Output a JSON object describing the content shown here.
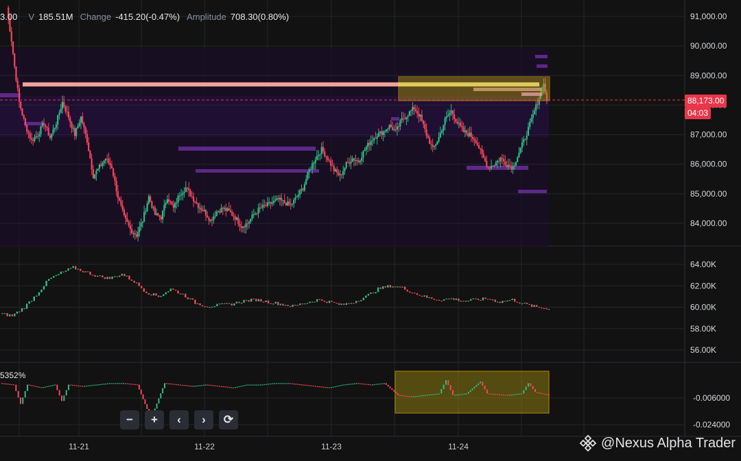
{
  "header": {
    "open_fragment": "3.00",
    "volume_label": "V",
    "volume_value": "185.51M",
    "change_label": "Change",
    "change_value": "-415.20(-0.47%)",
    "amplitude_label": "Amplitude",
    "amplitude_value": "708.30(0.80%)"
  },
  "price_badge": "88,173.00",
  "timer_badge": "04:03",
  "osc_label": "5352%",
  "watermark": "@Nexus Alpha Trader",
  "zoom_controls": [
    {
      "name": "zoom-out-button",
      "label": "−"
    },
    {
      "name": "zoom-in-button",
      "label": "+"
    },
    {
      "name": "scroll-left-button",
      "label": "‹"
    },
    {
      "name": "scroll-right-button",
      "label": "›"
    },
    {
      "name": "reset-button",
      "label": "⟳"
    }
  ],
  "colors": {
    "up": "#2ebd85",
    "down": "#f6465d",
    "accent_yellow": "#f0b90b",
    "grid": "#23262b"
  },
  "chart_data": [
    {
      "type": "candlestick",
      "panel": "price",
      "y_ticks": [
        "91,000.00",
        "90,000.00",
        "89,000.00",
        "88,000.00",
        "87,000.00",
        "86,000.00",
        "85,000.00",
        "84,000.00"
      ],
      "ylim": [
        83300,
        91300
      ],
      "x_ticks": [
        "11-21",
        "11-22",
        "11-23",
        "11-24"
      ],
      "last_price": 88173,
      "resistance_level": 88700,
      "path": [
        [
          0,
          91300
        ],
        [
          3,
          90200
        ],
        [
          5,
          89300
        ],
        [
          8,
          88100
        ],
        [
          12,
          87300
        ],
        [
          16,
          86800
        ],
        [
          20,
          87000
        ],
        [
          24,
          87400
        ],
        [
          28,
          86900
        ],
        [
          32,
          87400
        ],
        [
          36,
          88100
        ],
        [
          40,
          87600
        ],
        [
          44,
          87000
        ],
        [
          48,
          87600
        ],
        [
          52,
          86800
        ],
        [
          56,
          85600
        ],
        [
          60,
          85900
        ],
        [
          64,
          86200
        ],
        [
          68,
          85900
        ],
        [
          72,
          84900
        ],
        [
          76,
          84200
        ],
        [
          80,
          83800
        ],
        [
          84,
          83600
        ],
        [
          88,
          84100
        ],
        [
          92,
          84900
        ],
        [
          96,
          84300
        ],
        [
          100,
          84200
        ],
        [
          104,
          84900
        ],
        [
          108,
          84500
        ],
        [
          112,
          85000
        ],
        [
          116,
          85200
        ],
        [
          120,
          84900
        ],
        [
          124,
          84600
        ],
        [
          128,
          84400
        ],
        [
          132,
          84100
        ],
        [
          136,
          84400
        ],
        [
          140,
          84500
        ],
        [
          144,
          84400
        ],
        [
          148,
          84200
        ],
        [
          152,
          83900
        ],
        [
          156,
          84000
        ],
        [
          160,
          84300
        ],
        [
          164,
          84500
        ],
        [
          168,
          84600
        ],
        [
          172,
          84700
        ],
        [
          176,
          84800
        ],
        [
          180,
          84700
        ],
        [
          184,
          84600
        ],
        [
          188,
          84900
        ],
        [
          192,
          85200
        ],
        [
          196,
          85800
        ],
        [
          200,
          86200
        ],
        [
          204,
          86500
        ],
        [
          208,
          86200
        ],
        [
          212,
          85800
        ],
        [
          216,
          85600
        ],
        [
          220,
          86000
        ],
        [
          224,
          86200
        ],
        [
          228,
          86100
        ],
        [
          232,
          86500
        ],
        [
          236,
          86800
        ],
        [
          240,
          87000
        ],
        [
          244,
          87100
        ],
        [
          248,
          87300
        ],
        [
          252,
          87100
        ],
        [
          256,
          87500
        ],
        [
          260,
          87700
        ],
        [
          264,
          87900
        ],
        [
          268,
          87600
        ],
        [
          272,
          87000
        ],
        [
          276,
          86500
        ],
        [
          280,
          86900
        ],
        [
          284,
          87500
        ],
        [
          288,
          87800
        ],
        [
          292,
          87400
        ],
        [
          296,
          87100
        ],
        [
          300,
          87000
        ],
        [
          304,
          86800
        ],
        [
          308,
          86300
        ],
        [
          312,
          85900
        ],
        [
          316,
          86000
        ],
        [
          320,
          86200
        ],
        [
          324,
          86000
        ],
        [
          328,
          85900
        ],
        [
          332,
          86400
        ],
        [
          336,
          86900
        ],
        [
          340,
          87500
        ],
        [
          344,
          88100
        ],
        [
          348,
          88700
        ],
        [
          350,
          88173
        ]
      ],
      "volume_profile_note": "purple horizontal liquidity bands"
    },
    {
      "type": "line-candles",
      "panel": "open-interest",
      "y_ticks": [
        "64.00K",
        "62.00K",
        "60.00K",
        "58.00K",
        "56.00K"
      ],
      "ylim": [
        55000,
        65000
      ],
      "path": [
        [
          0,
          59400
        ],
        [
          10,
          59200
        ],
        [
          20,
          60000
        ],
        [
          30,
          61200
        ],
        [
          40,
          62600
        ],
        [
          50,
          63200
        ],
        [
          60,
          63700
        ],
        [
          70,
          63300
        ],
        [
          80,
          62900
        ],
        [
          90,
          62700
        ],
        [
          100,
          63100
        ],
        [
          110,
          62400
        ],
        [
          120,
          61400
        ],
        [
          130,
          61000
        ],
        [
          140,
          61700
        ],
        [
          150,
          61200
        ],
        [
          160,
          60400
        ],
        [
          170,
          60100
        ],
        [
          180,
          60200
        ],
        [
          190,
          60300
        ],
        [
          200,
          60600
        ],
        [
          210,
          60700
        ],
        [
          220,
          60500
        ],
        [
          230,
          60300
        ],
        [
          240,
          60100
        ],
        [
          250,
          60400
        ],
        [
          260,
          60700
        ],
        [
          270,
          60500
        ],
        [
          280,
          60200
        ],
        [
          290,
          60500
        ],
        [
          300,
          61000
        ],
        [
          310,
          61700
        ],
        [
          320,
          62000
        ],
        [
          330,
          61800
        ],
        [
          340,
          61300
        ],
        [
          350,
          60900
        ],
        [
          360,
          60700
        ],
        [
          370,
          60800
        ],
        [
          380,
          60600
        ],
        [
          390,
          60700
        ],
        [
          400,
          60800
        ],
        [
          410,
          60500
        ],
        [
          420,
          60700
        ],
        [
          430,
          60300
        ],
        [
          440,
          60000
        ],
        [
          450,
          59900
        ]
      ]
    },
    {
      "type": "line-candles",
      "panel": "funding-rate",
      "y_ticks": [
        "-0.006000",
        "-0.024000"
      ],
      "ylim": [
        -0.03,
        0.012
      ],
      "path": [
        [
          0,
          0.004
        ],
        [
          20,
          0.003
        ],
        [
          30,
          -0.01
        ],
        [
          40,
          0.003
        ],
        [
          60,
          0.001
        ],
        [
          80,
          0.003
        ],
        [
          90,
          -0.008
        ],
        [
          100,
          0.003
        ],
        [
          120,
          0.002
        ],
        [
          140,
          0.003
        ],
        [
          160,
          0.004
        ],
        [
          180,
          0.004
        ],
        [
          200,
          0.003
        ],
        [
          220,
          -0.02
        ],
        [
          240,
          0.004
        ],
        [
          260,
          0.003
        ],
        [
          280,
          0.002
        ],
        [
          300,
          0.003
        ],
        [
          320,
          0.002
        ],
        [
          340,
          0.001
        ],
        [
          360,
          0.003
        ],
        [
          380,
          0.003
        ],
        [
          400,
          0.004
        ],
        [
          420,
          0.004
        ],
        [
          440,
          0.003
        ],
        [
          460,
          0.002
        ],
        [
          480,
          0.001
        ],
        [
          500,
          0.003
        ],
        [
          520,
          0.004
        ],
        [
          540,
          0.003
        ],
        [
          560,
          0.004
        ],
        [
          580,
          -0.004
        ],
        [
          600,
          -0.005
        ],
        [
          620,
          -0.004
        ],
        [
          640,
          -0.003
        ],
        [
          650,
          0.006
        ],
        [
          660,
          -0.004
        ],
        [
          680,
          -0.003
        ],
        [
          700,
          0.005
        ],
        [
          710,
          -0.003
        ],
        [
          740,
          -0.004
        ],
        [
          760,
          -0.003
        ],
        [
          770,
          0.004
        ],
        [
          780,
          -0.002
        ],
        [
          800,
          -0.004
        ]
      ]
    }
  ]
}
